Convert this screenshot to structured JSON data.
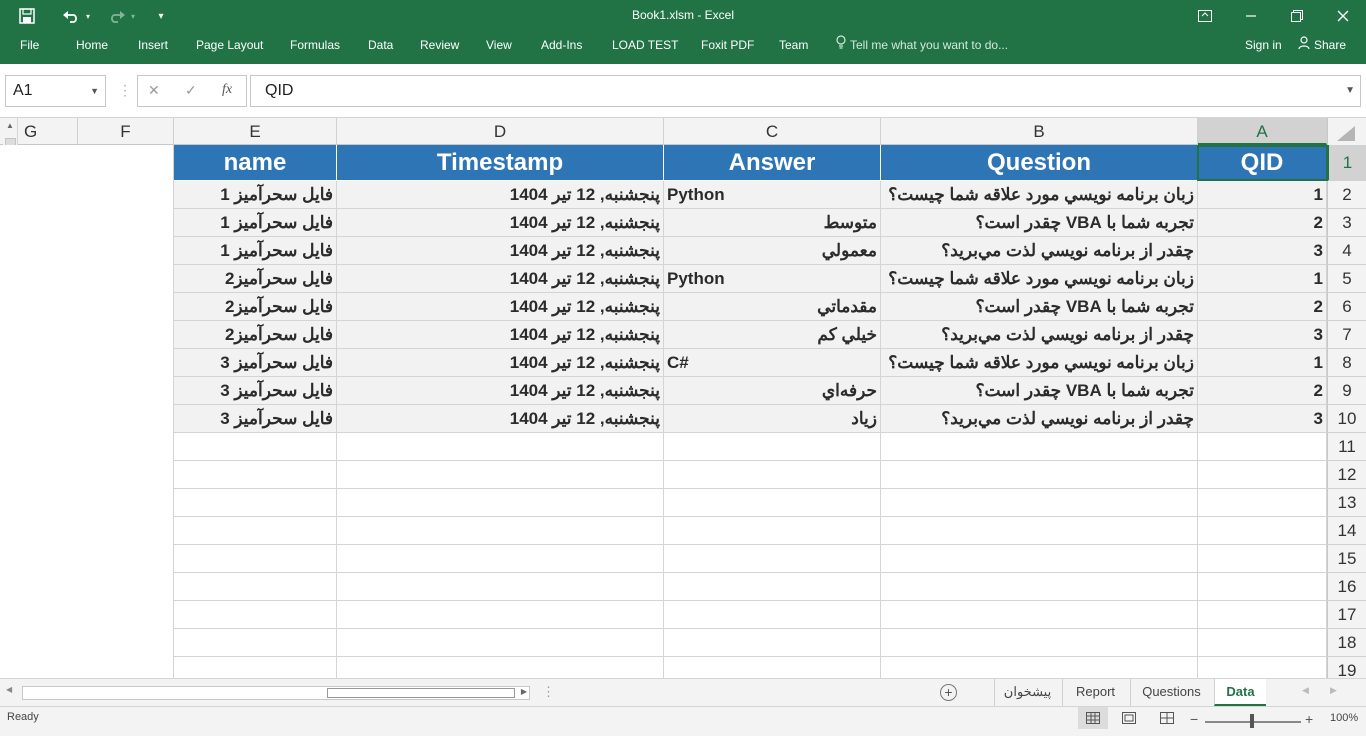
{
  "window": {
    "title": "Book1.xlsm - Excel",
    "qat_icons": [
      "save-icon",
      "undo-icon",
      "redo-icon",
      "customize-qat-icon"
    ],
    "controls": [
      "ribbon-display-icon",
      "minimize-icon",
      "restore-icon",
      "close-icon"
    ]
  },
  "ribbon": {
    "file": "File",
    "tabs": [
      "Home",
      "Insert",
      "Page Layout",
      "Formulas",
      "Data",
      "Review",
      "View",
      "Add-Ins",
      "LOAD TEST",
      "Foxit PDF",
      "Team"
    ],
    "tell_me": "Tell me what you want to do...",
    "sign_in": "Sign in",
    "share": "Share"
  },
  "formula_bar": {
    "name_box": "A1",
    "formula": "QID",
    "fx_label": "fx"
  },
  "columns": [
    "G",
    "F",
    "E",
    "D",
    "C",
    "B",
    "A"
  ],
  "active_column": "A",
  "table": {
    "headers": {
      "QID": "QID",
      "Question": "Question",
      "Answer": "Answer",
      "Timestamp": "Timestamp",
      "name": "name"
    },
    "rows": [
      {
        "qid": "1",
        "question": "زبان برنامه نويسي مورد علاقه شما چيست؟",
        "answer": "Python",
        "timestamp": "پنجشنبه, 12 تیر 1404",
        "name": "فايل سحرآميز 1"
      },
      {
        "qid": "2",
        "question": "تجربه شما با VBA چقدر است؟",
        "answer": "متوسط",
        "timestamp": "پنجشنبه, 12 تیر 1404",
        "name": "فايل سحرآميز 1"
      },
      {
        "qid": "3",
        "question": "چقدر از برنامه نويسي لذت مي‌بريد؟",
        "answer": "معمولي",
        "timestamp": "پنجشنبه, 12 تیر 1404",
        "name": "فايل سحرآميز 1"
      },
      {
        "qid": "1",
        "question": "زبان برنامه نويسي مورد علاقه شما چيست؟",
        "answer": "Python",
        "timestamp": "پنجشنبه, 12 تیر 1404",
        "name": "فايل سحرآميز2"
      },
      {
        "qid": "2",
        "question": "تجربه شما با VBA چقدر است؟",
        "answer": "مقدماتي",
        "timestamp": "پنجشنبه, 12 تیر 1404",
        "name": "فايل سحرآميز2"
      },
      {
        "qid": "3",
        "question": "چقدر از برنامه نويسي لذت مي‌بريد؟",
        "answer": "خيلي كم",
        "timestamp": "پنجشنبه, 12 تیر 1404",
        "name": "فايل سحرآميز2"
      },
      {
        "qid": "1",
        "question": "زبان برنامه نويسي مورد علاقه شما چيست؟",
        "answer": "C#",
        "timestamp": "پنجشنبه, 12 تیر 1404",
        "name": "فايل سحرآميز 3"
      },
      {
        "qid": "2",
        "question": "تجربه شما با VBA چقدر است؟",
        "answer": "حرفه‌اي",
        "timestamp": "پنجشنبه, 12 تیر 1404",
        "name": "فايل سحرآميز 3"
      },
      {
        "qid": "3",
        "question": "چقدر از برنامه نويسي لذت مي‌بريد؟",
        "answer": "زياد",
        "timestamp": "پنجشنبه, 12 تیر 1404",
        "name": "فايل سحرآميز 3"
      }
    ]
  },
  "row_numbers": [
    "1",
    "2",
    "3",
    "4",
    "5",
    "6",
    "7",
    "8",
    "9",
    "10",
    "11",
    "12",
    "13",
    "14",
    "15",
    "16",
    "17",
    "18",
    "19"
  ],
  "sheets": {
    "tabs": [
      "پيشخوان",
      "Report",
      "Questions",
      "Data"
    ],
    "active": "Data"
  },
  "status": {
    "ready": "Ready",
    "zoom": "100%"
  },
  "colors": {
    "excel_green": "#217346",
    "header_blue": "#2e75b6"
  }
}
